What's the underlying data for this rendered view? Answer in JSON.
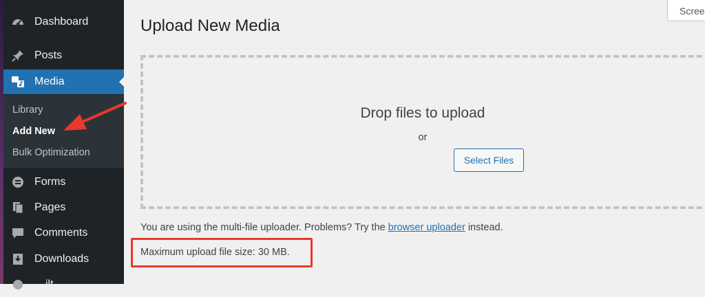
{
  "sidebar": {
    "items": [
      {
        "label": "Dashboard",
        "icon": "dashboard-icon"
      },
      {
        "label": "Posts",
        "icon": "pin-icon"
      },
      {
        "label": "Media",
        "icon": "media-icon"
      },
      {
        "label": "Forms",
        "icon": "forms-icon"
      },
      {
        "label": "Pages",
        "icon": "pages-icon"
      },
      {
        "label": "Comments",
        "icon": "comments-icon"
      },
      {
        "label": "Downloads",
        "icon": "download-icon"
      },
      {
        "label": "…ilt",
        "icon": "generic-icon"
      }
    ],
    "submenu": [
      "Library",
      "Add New",
      "Bulk Optimization"
    ],
    "active_item": "Media",
    "current_subitem": "Add New"
  },
  "screen_options": {
    "label": "Scree"
  },
  "main": {
    "title": "Upload New Media",
    "drop_title": "Drop files to upload",
    "drop_or": "or",
    "select_button": "Select Files",
    "note_prefix": "You are using the multi-file uploader. Problems? Try the ",
    "note_link": "browser uploader",
    "note_suffix": " instead.",
    "max_size": "Maximum upload file size: 30 MB."
  },
  "colors": {
    "sidebar_bg": "#1d2327",
    "accent": "#2271b1",
    "annotation": "#e9382b"
  }
}
